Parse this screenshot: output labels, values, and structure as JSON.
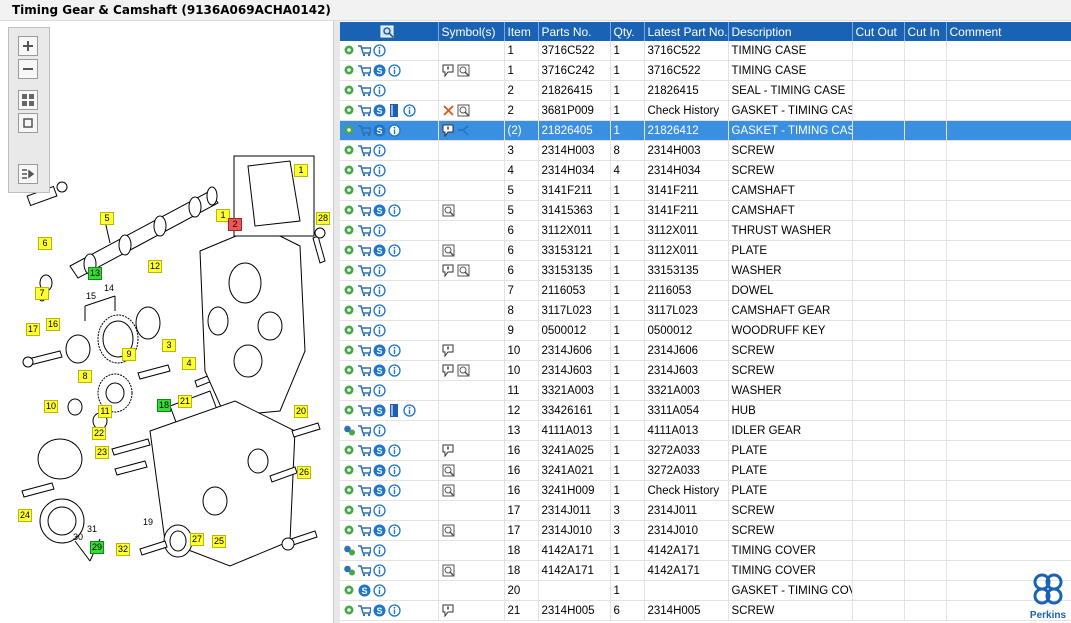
{
  "window": {
    "title": "Timing Gear & Camshaft (9136A069ACHA0142)"
  },
  "toolbar": {
    "buttons": [
      {
        "name": "zoom-in-button",
        "icon": "plus-icon"
      },
      {
        "name": "zoom-out-button",
        "icon": "minus-icon"
      },
      {
        "name": "fit-all-button",
        "icon": "grid-icon"
      },
      {
        "name": "actual-size-button",
        "icon": "square-icon"
      },
      {
        "name": "export-button",
        "icon": "export-icon"
      }
    ]
  },
  "callouts": [
    {
      "label": "1",
      "style": "y"
    },
    {
      "label": "1",
      "style": "y"
    },
    {
      "label": "2",
      "style": "r"
    },
    {
      "label": "28",
      "style": "y"
    },
    {
      "label": "5",
      "style": "y"
    },
    {
      "label": "6",
      "style": "y"
    },
    {
      "label": "7",
      "style": "y"
    },
    {
      "label": "13",
      "style": "g"
    },
    {
      "label": "15",
      "style": "p"
    },
    {
      "label": "14",
      "style": "p"
    },
    {
      "label": "12",
      "style": "y"
    },
    {
      "label": "16",
      "style": "y"
    },
    {
      "label": "17",
      "style": "y"
    },
    {
      "label": "9",
      "style": "y"
    },
    {
      "label": "3",
      "style": "y"
    },
    {
      "label": "8",
      "style": "y"
    },
    {
      "label": "4",
      "style": "y"
    },
    {
      "label": "10",
      "style": "y"
    },
    {
      "label": "11",
      "style": "y"
    },
    {
      "label": "21",
      "style": "y"
    },
    {
      "label": "18",
      "style": "g"
    },
    {
      "label": "20",
      "style": "y"
    },
    {
      "label": "22",
      "style": "y"
    },
    {
      "label": "23",
      "style": "y"
    },
    {
      "label": "26",
      "style": "y"
    },
    {
      "label": "24",
      "style": "y"
    },
    {
      "label": "31",
      "style": "p"
    },
    {
      "label": "30",
      "style": "p"
    },
    {
      "label": "29",
      "style": "g"
    },
    {
      "label": "19",
      "style": "p"
    },
    {
      "label": "27",
      "style": "y"
    },
    {
      "label": "25",
      "style": "y"
    },
    {
      "label": "32",
      "style": "y"
    }
  ],
  "table": {
    "columns": [
      "",
      "Symbol(s)",
      "Item",
      "Parts No.",
      "Qty.",
      "Latest Part No.",
      "Description",
      "Cut Out",
      "Cut In",
      "Comment"
    ],
    "header_icon": "search-catalog-icon",
    "rows": [
      {
        "icons": [
          "gear",
          "cart",
          "info"
        ],
        "sym": [],
        "item": "1",
        "part": "3716C522",
        "qty": "1",
        "latest": "3716C522",
        "desc": "TIMING CASE"
      },
      {
        "icons": [
          "gear",
          "cart",
          "s",
          "info"
        ],
        "sym": [
          "note",
          "view"
        ],
        "item": "1",
        "part": "3716C242",
        "qty": "1",
        "latest": "3716C522",
        "desc": "TIMING CASE"
      },
      {
        "icons": [
          "gear",
          "cart",
          "info"
        ],
        "sym": [],
        "item": "2",
        "part": "21826415",
        "qty": "1",
        "latest": "21826415",
        "desc": "SEAL - TIMING CASE"
      },
      {
        "icons": [
          "gear",
          "cart",
          "s",
          "book",
          "info"
        ],
        "sym": [
          "x",
          "view"
        ],
        "item": "2",
        "part": "3681P009",
        "qty": "1",
        "latest": "Check History",
        "desc": "GASKET - TIMING CASE"
      },
      {
        "icons": [
          "gear",
          "cart",
          "s",
          "info"
        ],
        "sym": [
          "note",
          "link"
        ],
        "item": "(2)",
        "part": "21826405",
        "qty": "1",
        "latest": "21826412",
        "desc": "GASKET - TIMING CASE",
        "selected": true
      },
      {
        "icons": [
          "gear",
          "cart",
          "info"
        ],
        "sym": [],
        "item": "3",
        "part": "2314H003",
        "qty": "8",
        "latest": "2314H003",
        "desc": "SCREW"
      },
      {
        "icons": [
          "gear",
          "cart",
          "info"
        ],
        "sym": [],
        "item": "4",
        "part": "2314H034",
        "qty": "4",
        "latest": "2314H034",
        "desc": "SCREW"
      },
      {
        "icons": [
          "gear",
          "cart",
          "info"
        ],
        "sym": [],
        "item": "5",
        "part": "3141F211",
        "qty": "1",
        "latest": "3141F211",
        "desc": "CAMSHAFT"
      },
      {
        "icons": [
          "gear",
          "cart",
          "s",
          "info"
        ],
        "sym": [
          "view"
        ],
        "item": "5",
        "part": "31415363",
        "qty": "1",
        "latest": "3141F211",
        "desc": "CAMSHAFT"
      },
      {
        "icons": [
          "gear",
          "cart",
          "info"
        ],
        "sym": [],
        "item": "6",
        "part": "3112X011",
        "qty": "1",
        "latest": "3112X011",
        "desc": "THRUST WASHER"
      },
      {
        "icons": [
          "gear",
          "cart",
          "s",
          "info"
        ],
        "sym": [
          "view"
        ],
        "item": "6",
        "part": "33153121",
        "qty": "1",
        "latest": "3112X011",
        "desc": "PLATE"
      },
      {
        "icons": [
          "gear",
          "cart",
          "info"
        ],
        "sym": [
          "note",
          "view"
        ],
        "item": "6",
        "part": "33153135",
        "qty": "1",
        "latest": "33153135",
        "desc": "WASHER"
      },
      {
        "icons": [
          "gear",
          "cart",
          "info"
        ],
        "sym": [],
        "item": "7",
        "part": "2116053",
        "qty": "1",
        "latest": "2116053",
        "desc": "DOWEL"
      },
      {
        "icons": [
          "gear",
          "cart",
          "info"
        ],
        "sym": [],
        "item": "8",
        "part": "3117L023",
        "qty": "1",
        "latest": "3117L023",
        "desc": "CAMSHAFT GEAR"
      },
      {
        "icons": [
          "gear",
          "cart",
          "info"
        ],
        "sym": [],
        "item": "9",
        "part": "0500012",
        "qty": "1",
        "latest": "0500012",
        "desc": "WOODRUFF KEY"
      },
      {
        "icons": [
          "gear",
          "cart",
          "s",
          "info"
        ],
        "sym": [
          "note"
        ],
        "item": "10",
        "part": "2314J606",
        "qty": "1",
        "latest": "2314J606",
        "desc": "SCREW"
      },
      {
        "icons": [
          "gear",
          "cart",
          "s",
          "info"
        ],
        "sym": [
          "note",
          "view"
        ],
        "item": "10",
        "part": "2314J603",
        "qty": "1",
        "latest": "2314J603",
        "desc": "SCREW"
      },
      {
        "icons": [
          "gear",
          "cart",
          "info"
        ],
        "sym": [],
        "item": "11",
        "part": "3321A003",
        "qty": "1",
        "latest": "3321A003",
        "desc": "WASHER"
      },
      {
        "icons": [
          "gear",
          "cart",
          "s",
          "book",
          "info"
        ],
        "sym": [],
        "item": "12",
        "part": "33426161",
        "qty": "1",
        "latest": "3311A054",
        "desc": "HUB"
      },
      {
        "icons": [
          "gears",
          "cart",
          "info"
        ],
        "sym": [],
        "item": "13",
        "part": "4111A013",
        "qty": "1",
        "latest": "4111A013",
        "desc": "IDLER GEAR"
      },
      {
        "icons": [
          "gear",
          "cart",
          "s",
          "info"
        ],
        "sym": [
          "note"
        ],
        "item": "16",
        "part": "3241A025",
        "qty": "1",
        "latest": "3272A033",
        "desc": "PLATE"
      },
      {
        "icons": [
          "gear",
          "cart",
          "s",
          "info"
        ],
        "sym": [
          "view"
        ],
        "item": "16",
        "part": "3241A021",
        "qty": "1",
        "latest": "3272A033",
        "desc": "PLATE"
      },
      {
        "icons": [
          "gear",
          "cart",
          "s",
          "info"
        ],
        "sym": [
          "view"
        ],
        "item": "16",
        "part": "3241H009",
        "qty": "1",
        "latest": "Check History",
        "desc": "PLATE"
      },
      {
        "icons": [
          "gear",
          "cart",
          "info"
        ],
        "sym": [],
        "item": "17",
        "part": "2314J011",
        "qty": "3",
        "latest": "2314J011",
        "desc": "SCREW"
      },
      {
        "icons": [
          "gear",
          "cart",
          "s",
          "info"
        ],
        "sym": [
          "view"
        ],
        "item": "17",
        "part": "2314J010",
        "qty": "3",
        "latest": "2314J010",
        "desc": "SCREW"
      },
      {
        "icons": [
          "gears",
          "cart",
          "info"
        ],
        "sym": [],
        "item": "18",
        "part": "4142A171",
        "qty": "1",
        "latest": "4142A171",
        "desc": "TIMING COVER"
      },
      {
        "icons": [
          "gears",
          "cart",
          "info"
        ],
        "sym": [
          "view"
        ],
        "item": "18",
        "part": "4142A171",
        "qty": "1",
        "latest": "4142A171",
        "desc": "TIMING COVER"
      },
      {
        "icons": [
          "gear",
          "s",
          "info"
        ],
        "sym": [],
        "item": "20",
        "part": "",
        "qty": "1",
        "latest": "",
        "desc": "GASKET - TIMING COVEI"
      },
      {
        "icons": [
          "gear",
          "cart",
          "s",
          "info"
        ],
        "sym": [
          "note"
        ],
        "item": "21",
        "part": "2314H005",
        "qty": "6",
        "latest": "2314H005",
        "desc": "SCREW"
      }
    ]
  },
  "brand": {
    "name": "Perkins",
    "color": "#1a62b3"
  },
  "colors": {
    "header": "#1a62b3",
    "selected": "#3b8fe0",
    "gear": "#45a845",
    "callout": "#ffff33",
    "callout_green": "#33dd33"
  }
}
